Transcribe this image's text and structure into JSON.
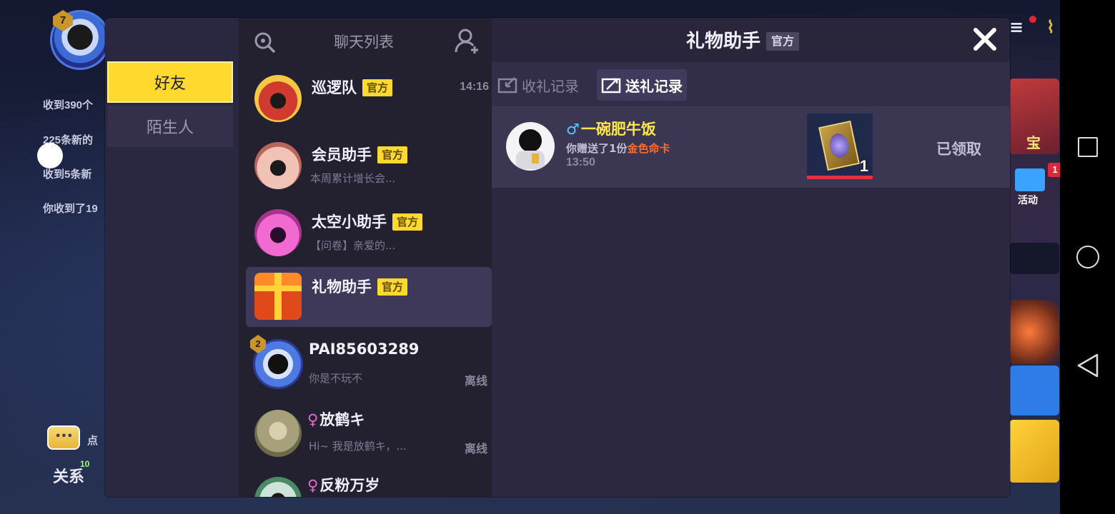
{
  "background": {
    "rank": "7",
    "notifications": [
      "收到390个",
      "225条新的",
      "收到5条新",
      "你收到了19"
    ],
    "relation_label": "关系",
    "relation_count": "10",
    "chat_hint": "点",
    "activity_label": "活动",
    "activity_badge": "1",
    "treasure_label": "宝"
  },
  "tabs": [
    {
      "label": "好友",
      "active": true
    },
    {
      "label": "陌生人",
      "active": false
    }
  ],
  "chat_list": {
    "title": "聊天列表",
    "search_icon": "search-icon",
    "add_friend_icon": "add-friend-icon",
    "items": [
      {
        "name": "巡逻队",
        "official": "官方",
        "preview": "",
        "time": "14:16",
        "status": ""
      },
      {
        "name": "会员助手",
        "official": "官方",
        "preview": "本周累计增长会...",
        "time": "",
        "status": ""
      },
      {
        "name": "太空小助手",
        "official": "官方",
        "preview": "【问卷】亲爱的...",
        "time": "",
        "status": ""
      },
      {
        "name": "礼物助手",
        "official": "官方",
        "preview": "",
        "time": "",
        "status": "",
        "selected": true
      },
      {
        "name": "PAI85603289",
        "official": "",
        "preview": "你是不玩不",
        "time": "",
        "status": "离线",
        "level": "2"
      },
      {
        "name": "放鹤キ",
        "gender": "♀",
        "preview": "Hi~ 我是放鹤キ，...",
        "time": "",
        "status": "离线"
      },
      {
        "name": "反粉万岁",
        "gender": "♀",
        "preview": "",
        "time": "",
        "status": ""
      }
    ]
  },
  "detail": {
    "title": "礼物助手",
    "official_tag": "官方",
    "close_icon": "close-icon",
    "sub_tabs": [
      {
        "label": "收礼记录",
        "active": false
      },
      {
        "label": "送礼记录",
        "active": true
      }
    ],
    "records": [
      {
        "gender": "♂",
        "name": "一碗肥牛饭",
        "desc_prefix": "你赠送了1份",
        "gift_name": "金色命卡",
        "time": "13:50",
        "gift_qty": "1",
        "status": "已领取"
      }
    ]
  },
  "colors": {
    "accent_yellow": "#ffd92e",
    "panel": "#2f2b44",
    "gift_highlight": "#ff6a2b",
    "name_yellow": "#ffe64a"
  }
}
